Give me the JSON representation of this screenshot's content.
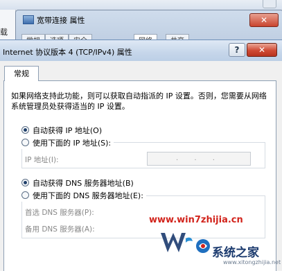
{
  "background_window": {
    "title": "宽带连接 属性",
    "tabs": [
      "常规",
      "选项",
      "安全",
      "网络",
      "共享"
    ],
    "left_text": "载",
    "close_label": "✕"
  },
  "dialog": {
    "title": "Internet 协议版本 4 (TCP/IPv4) 属性",
    "help_label": "?",
    "close_label": "✕",
    "tab_general": "常规",
    "description": "如果网络支持此功能，则可以获取自动指派的 IP 设置。否则，您需要从网络系统管理员处获得适当的 IP 设置。",
    "ip": {
      "auto_label": "自动获得 IP 地址(O)",
      "manual_label": "使用下面的 IP 地址(S):",
      "auto_selected": true,
      "address_label": "IP 地址(I):",
      "address_value": ". . ."
    },
    "dns": {
      "auto_label": "自动获得 DNS 服务器地址(B)",
      "manual_label": "使用下面的 DNS 服务器地址(E):",
      "auto_selected": true,
      "preferred_label": "首选 DNS 服务器(P):",
      "alternate_label": "备用 DNS 服务器(A):"
    }
  },
  "watermark": {
    "site": "www.win7zhijia.cn",
    "brand": "系统之家",
    "url": "www.xitongzhijia.net",
    "colors": {
      "red": "#d2241c",
      "blue": "#1b3a6e"
    }
  }
}
